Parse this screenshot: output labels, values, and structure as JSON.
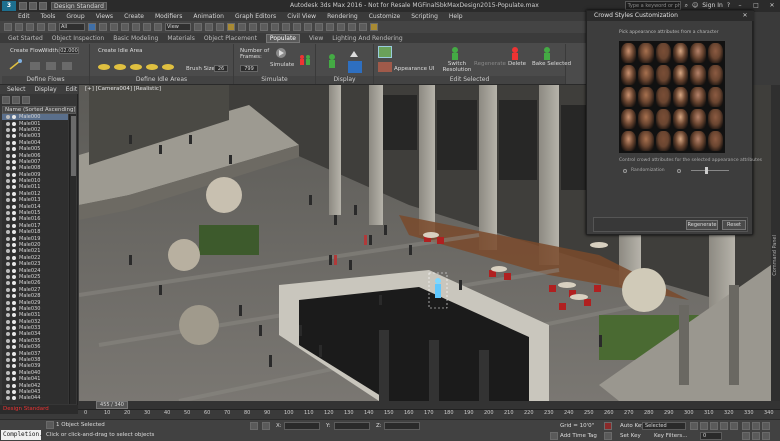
{
  "app": {
    "logo": "3",
    "workspace": "Design Standard",
    "window_title": "Autodesk 3ds Max 2016 - Not for Resale   MGFinalSbkMaxDesign2015-Populate.max",
    "search_placeholder": "Type a keyword or phrase",
    "sign_in": "Sign In",
    "window_buttons": [
      "–",
      "□",
      "✕"
    ]
  },
  "menu": [
    "Edit",
    "Tools",
    "Group",
    "Views",
    "Create",
    "Modifiers",
    "Animation",
    "Graph Editors",
    "Civil View",
    "Rendering",
    "Customize",
    "Scripting",
    "Help"
  ],
  "toolbar": {
    "filter": "All",
    "view": "View"
  },
  "ribbon_tabs": [
    {
      "label": "Get Started",
      "active": false
    },
    {
      "label": "Object Inspection",
      "active": false
    },
    {
      "label": "Basic Modeling",
      "active": false
    },
    {
      "label": "Materials",
      "active": false
    },
    {
      "label": "Object Placement",
      "active": false
    },
    {
      "label": "Populate",
      "active": true
    },
    {
      "label": "View",
      "active": false
    },
    {
      "label": "Lighting And Rendering",
      "active": false
    }
  ],
  "ribbon": {
    "define_flows": {
      "title": "Define Flows",
      "create_flow": "Create Flow",
      "width_label": "Width:",
      "width_value": "02.000"
    },
    "define_idle": {
      "title": "Define Idle Areas",
      "create_idle": "Create Idle Area",
      "brush_label": "Brush Size:",
      "brush_value": "26"
    },
    "simulate": {
      "title": "Simulate",
      "frames_label": "Number of Frames:",
      "frames_value": "799",
      "simulate_label": "Simulate"
    },
    "display": {
      "title": "Display"
    },
    "edit_selected": {
      "title": "Edit Selected",
      "appearance_label": "Appearance UI",
      "switch_label": "Switch Resolution",
      "regenerate_label": "Regenerate",
      "delete_label": "Delete",
      "bake_label": "Bake Selected"
    }
  },
  "scene_explorer": {
    "menu": [
      "Select",
      "Display",
      "Edit"
    ],
    "sort": "Name (Sorted Ascending)",
    "items": [
      "Male000",
      "Male001",
      "Male002",
      "Male003",
      "Male004",
      "Male005",
      "Male006",
      "Male007",
      "Male008",
      "Male009",
      "Male010",
      "Male011",
      "Male012",
      "Male013",
      "Male014",
      "Male015",
      "Male016",
      "Male017",
      "Male018",
      "Male019",
      "Male020",
      "Male021",
      "Male022",
      "Male023",
      "Male024",
      "Male025",
      "Male026",
      "Male027",
      "Male028",
      "Male029",
      "Male030",
      "Male031",
      "Male032",
      "Male033",
      "Male034",
      "Male035",
      "Male036",
      "Male037",
      "Male038",
      "Male039",
      "Male040",
      "Male041",
      "Male042",
      "Male043",
      "Male044"
    ],
    "selected_index": 0,
    "footer": "Design Standard"
  },
  "viewport": {
    "label": "[+] [Camera004] [Realistic]"
  },
  "right_strip": "Command Panel",
  "dialog": {
    "title": "Crowd Styles Customization",
    "close": "✕",
    "heading": "Pick appearance attributes from a character",
    "subtext": "Control crowd attributes for the selected appearance attributes",
    "option_label": "Randomization",
    "regenerate": "Regenerate",
    "reset": "Reset"
  },
  "timeline": {
    "position": "455 / 340",
    "ticks": [
      "0",
      "5",
      "10",
      "15",
      "20",
      "25",
      "30",
      "35",
      "40",
      "45",
      "50",
      "55",
      "60",
      "65",
      "70",
      "75",
      "80",
      "85",
      "90",
      "95",
      "100",
      "105",
      "110",
      "115",
      "120",
      "125",
      "130",
      "135",
      "140",
      "145",
      "150",
      "155",
      "160",
      "165",
      "170",
      "175",
      "180",
      "185",
      "190",
      "195",
      "200",
      "205",
      "210",
      "215",
      "220",
      "225",
      "230",
      "235",
      "240",
      "245",
      "250",
      "255",
      "260",
      "265",
      "270",
      "275",
      "280",
      "285",
      "290",
      "295",
      "300",
      "305",
      "310",
      "315",
      "320",
      "325",
      "330",
      "335",
      "340"
    ]
  },
  "statusbar": {
    "completion": "Completion.",
    "selected": "1 Object Selected",
    "hint": "Click or click-and-drag to select objects",
    "x_label": "X:",
    "y_label": "Y:",
    "z_label": "Z:",
    "grid": "Grid = 10'0\"",
    "add_time_tag": "Add Time Tag",
    "auto_key": "Auto Key",
    "set_key": "Set Key",
    "selected_dropdown": "Selected",
    "key_filters": "Key Filters...",
    "frame": "0"
  }
}
